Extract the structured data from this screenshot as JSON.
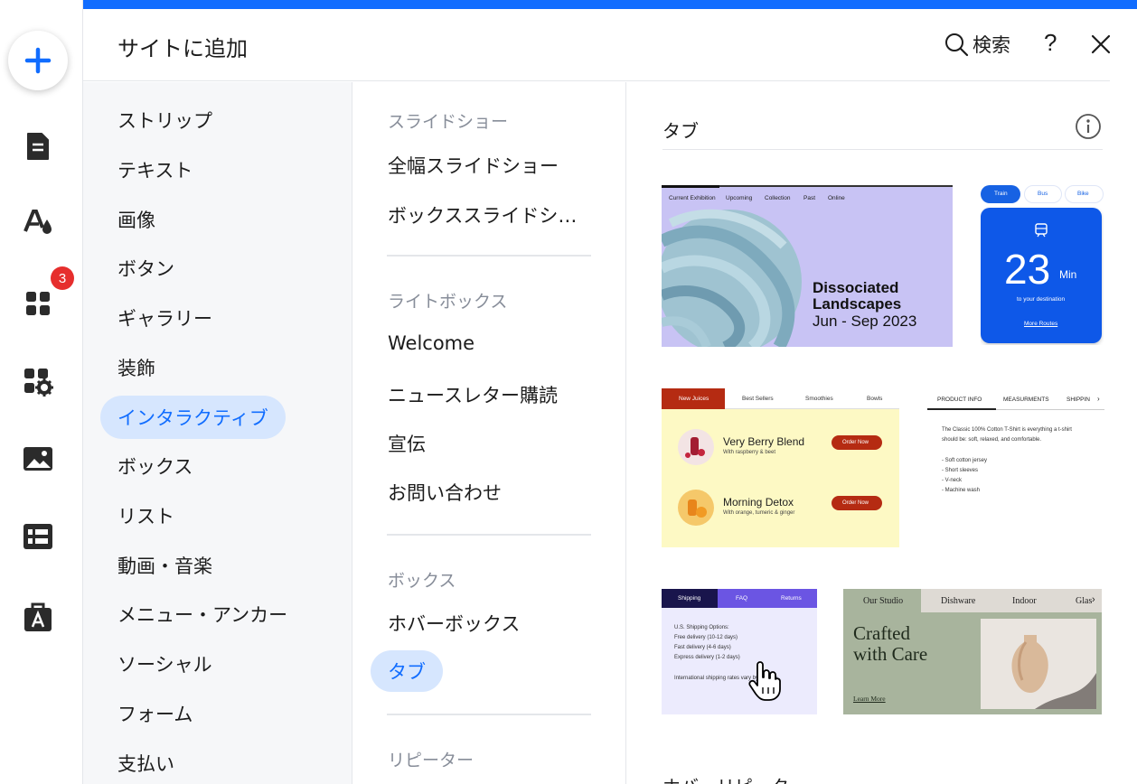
{
  "rail": {
    "badge_count": "3",
    "icons": [
      "plus-icon",
      "page-icon",
      "theme-icon",
      "apps-icon",
      "settings-apps-icon",
      "media-icon",
      "table-icon",
      "business-icon"
    ]
  },
  "header": {
    "title": "サイトに追加",
    "search_label": "検索",
    "help_label": "?"
  },
  "categories": [
    "ストリップ",
    "テキスト",
    "画像",
    "ボタン",
    "ギャラリー",
    "装飾",
    "インタラクティブ",
    "ボックス",
    "リスト",
    "動画・音楽",
    "メニュー・アンカー",
    "ソーシャル",
    "フォーム",
    "支払い"
  ],
  "active_category": "インタラクティブ",
  "subsections": {
    "slideshow_head": "スライドショー",
    "slideshow_items": [
      "全幅スライドショー",
      "ボックススライドシ…"
    ],
    "lightbox_head": "ライトボックス",
    "lightbox_items": [
      "Welcome",
      "ニュースレター購読",
      "宣伝",
      "お問い合わせ"
    ],
    "box_head": "ボックス",
    "box_items": [
      "ホバーボックス",
      "タブ"
    ],
    "repeater_head": "リピーター"
  },
  "right": {
    "title": "タブ",
    "next_title": "ホバーリピータ"
  },
  "thumb1": {
    "tabs": [
      "Current Exhibition",
      "Upcoming",
      "Collection",
      "Past",
      "Online"
    ],
    "title1": "Dissociated",
    "title2": "Landscapes",
    "dates": "Jun - Sep 2023"
  },
  "thumb2": {
    "tabs": [
      "Train",
      "Bus",
      "Bike"
    ],
    "number": "23",
    "unit": "Min",
    "caption": "to your destination",
    "link": "More Routes"
  },
  "thumb3": {
    "tabs": [
      "New Juices",
      "Best Sellers",
      "Smoothies",
      "Bowls"
    ],
    "item1_name": "Very Berry Blend",
    "item1_desc": "With raspberry & beet",
    "item2_name": "Morning Detox",
    "item2_desc": "With orange, tumeric & ginger",
    "button": "Order Now"
  },
  "thumb4": {
    "tabs": [
      "PRODUCT INFO",
      "MEASURMENTS",
      "SHIPPIN"
    ],
    "desc1": "The Classic 100% Cotton T-Shirt is everything a t-shirt",
    "desc2": "should be: soft, relaxed, and comfortable.",
    "bullets": [
      "- Soft cotton jersey",
      "- Short sleeves",
      "- V-neck",
      "- Machine wash"
    ]
  },
  "thumb5": {
    "tabs": [
      "Shipping",
      "FAQ",
      "Returns"
    ],
    "lines": [
      "U.S. Shipping Options:",
      "Free delivery (10-12 days)",
      "Fast delivery (4-6 days)",
      "Express delivery (1-2 days)"
    ],
    "note": "International shipping rates vary by country."
  },
  "thumb6": {
    "tabs": [
      "Our Studio",
      "Dishware",
      "Indoor",
      "Glas"
    ],
    "title1": "Crafted",
    "title2": "with Care",
    "link": "Learn More"
  },
  "colors": {
    "accent": "#116dff",
    "active_bg": "#d6e6fe",
    "badge": "#e62e2d"
  }
}
